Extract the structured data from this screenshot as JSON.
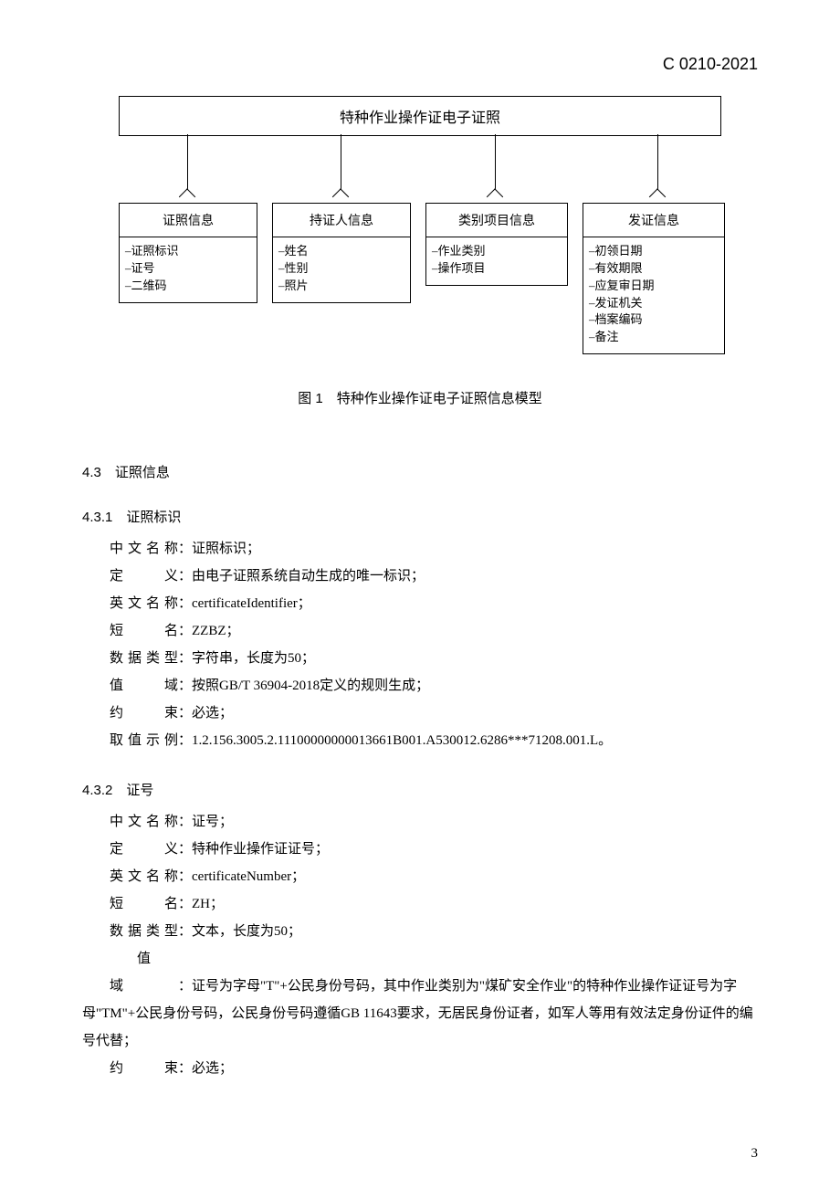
{
  "header": "C 0210-2021",
  "diagram": {
    "title": "特种作业操作证电子证照",
    "boxes": [
      {
        "title": "证照信息",
        "items": [
          "证照标识",
          "证号",
          "二维码"
        ]
      },
      {
        "title": "持证人信息",
        "items": [
          "姓名",
          "性别",
          "照片"
        ]
      },
      {
        "title": "类别项目信息",
        "items": [
          "作业类别",
          "操作项目"
        ]
      },
      {
        "title": "发证信息",
        "items": [
          "初领日期",
          "有效期限",
          "应复审日期",
          "发证机关",
          "档案编码",
          "备注"
        ]
      }
    ]
  },
  "figcaption": "图 1　特种作业操作证电子证照信息模型",
  "s43": "4.3　证照信息",
  "s431": {
    "title": "4.3.1　证照标识",
    "cn": "证照标识；",
    "def": "由电子证照系统自动生成的唯一标识；",
    "en": "certificateIdentifier；",
    "short": "ZZBZ；",
    "dtype": "字符串，长度为50；",
    "domain": "按照GB/T 36904-2018定义的规则生成；",
    "constraint": "必选；",
    "example": "1.2.156.3005.2.11100000000013661B001.A530012.6286***71208.001.L。"
  },
  "s432": {
    "title": "4.3.2　证号",
    "cn": "证号；",
    "def": "特种作业操作证证号；",
    "en": "certificateNumber；",
    "short": "ZH；",
    "dtype": "文本，长度为50；",
    "domain": "证号为字母\"T\"+公民身份号码，其中作业类别为\"煤矿安全作业\"的特种作业操作证证号为字母\"TM\"+公民身份号码，公民身份号码遵循GB 11643要求，无居民身份证者，如军人等用有效法定身份证件的编号代替；",
    "constraint": "必选；"
  },
  "labels": {
    "cn": "中文名称",
    "def": "定　　义",
    "en": "英文名称",
    "short": "短　　名",
    "dtype": "数据类型",
    "domain": "值　　域",
    "constraint": "约　　束",
    "example": "取值示例"
  },
  "pagenum": "3"
}
